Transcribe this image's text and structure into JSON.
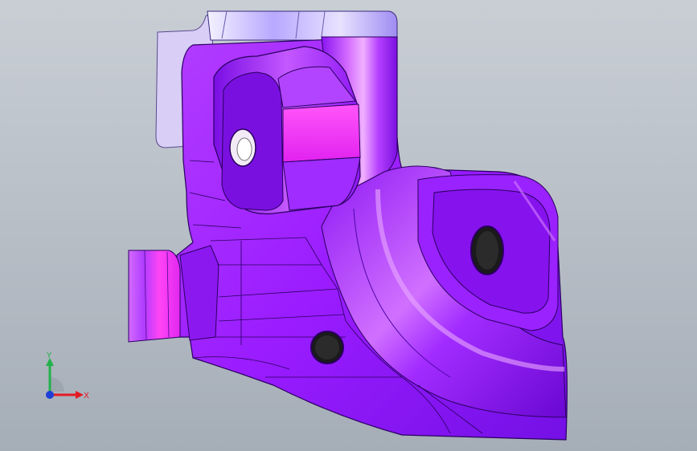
{
  "triad": {
    "y_label": "Y",
    "x_label": "X",
    "y_color": "#22b14c",
    "x_color": "#e31b23",
    "z_color": "#1f3fd6"
  },
  "colors": {
    "part_main": "#9b22ff",
    "part_light": "#c95cff",
    "part_face": "#ff3cf7",
    "part_dark": "#6a0fd6",
    "flange_pale": "#d8cdf6",
    "edge": "#2a0060"
  }
}
